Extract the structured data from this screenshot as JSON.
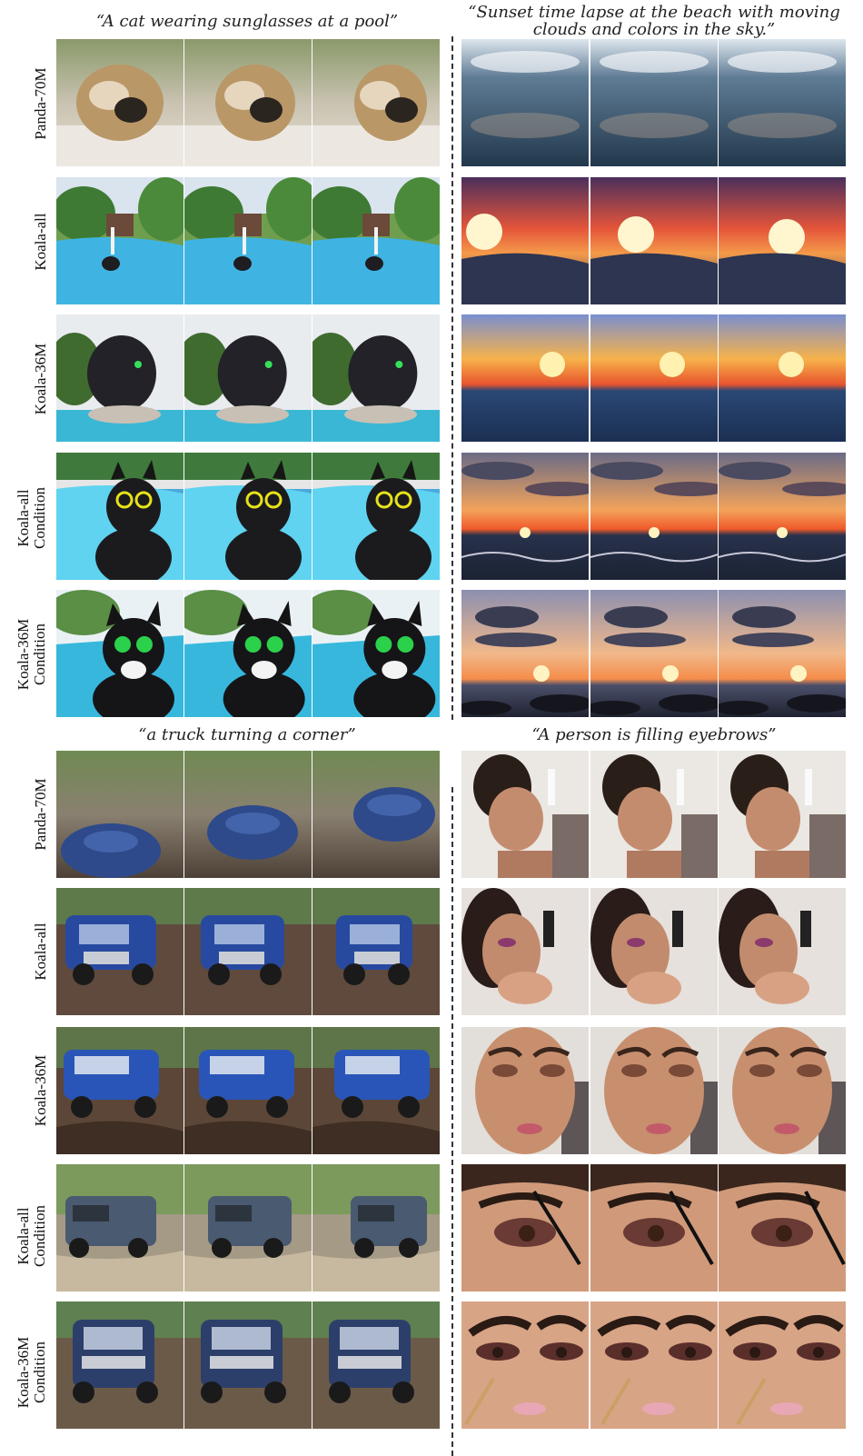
{
  "panels": [
    {
      "caption": "“A cat wearing sunglasses at a pool”",
      "row_labels": [
        [
          "Panda-70M"
        ],
        [
          "Koala-all"
        ],
        [
          "Koala-36M"
        ],
        [
          "Koala-all",
          "Condition"
        ],
        [
          "Koala-36M",
          "Condition"
        ]
      ],
      "scenes": [
        "blurry-cat",
        "pool-jumper",
        "black-cat-pool",
        "cat-sunglasses-pool",
        "cat-sunglasses-pool-2"
      ]
    },
    {
      "caption_lines": [
        "“Sunset time lapse at the beach with moving",
        "clouds and colors in the sky.”"
      ],
      "scenes": [
        "grey-sea",
        "red-sunset",
        "orange-sunset",
        "sunset-waves",
        "sunset-rocks"
      ]
    },
    {
      "caption": "“a truck turning a corner”",
      "row_labels": [
        [
          "Panda-70M"
        ],
        [
          "Koala-all"
        ],
        [
          "Koala-36M"
        ],
        [
          "Koala-all",
          "Condition"
        ],
        [
          "Koala-36M",
          "Condition"
        ]
      ],
      "scenes": [
        "blurry-truck",
        "blue-truck",
        "blue-truck-mud",
        "grey-truck",
        "blue-suv"
      ]
    },
    {
      "caption": "“A person is filling eyebrows”",
      "scenes": [
        "woman-profile",
        "woman-eyeshadow",
        "woman-closeup",
        "eyebrow-pencil",
        "eyebrow-closeup"
      ]
    }
  ]
}
